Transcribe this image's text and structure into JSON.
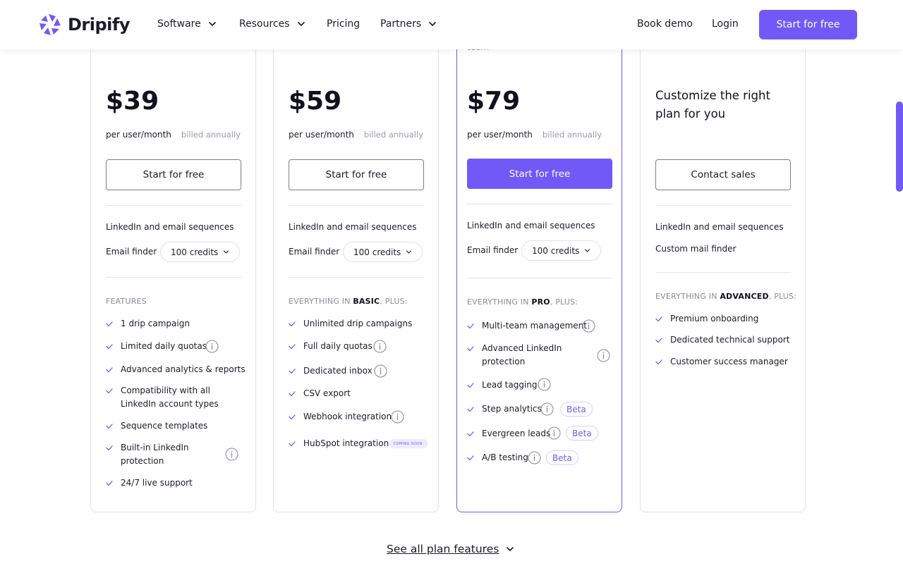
{
  "nav": {
    "logo_text": "Dripify",
    "items": [
      {
        "label": "Software",
        "dropdown": true
      },
      {
        "label": "Resources",
        "dropdown": true
      },
      {
        "label": "Pricing",
        "dropdown": false
      },
      {
        "label": "Partners",
        "dropdown": true
      }
    ],
    "book_demo": "Book demo",
    "login": "Login",
    "cta": "Start for free"
  },
  "accent_color": "#7159f8",
  "plans": [
    {
      "price": "$39",
      "per": "per user/month",
      "billed": "billed annually",
      "button": "Start for free",
      "sequences": "LinkedIn and email sequences",
      "email_finder_label": "Email finder",
      "credits": "100 credits",
      "section_head": "FEATURES",
      "features": [
        "1 drip campaign",
        "Limited daily quotas",
        "Advanced analytics & reports",
        "Compatibility with all LinkedIn account types",
        "Sequence templates",
        "Built-in LinkedIn protection",
        "24/7 live support"
      ]
    },
    {
      "price": "$59",
      "per": "per user/month",
      "billed": "billed annually",
      "button": "Start for free",
      "sequences": "LinkedIn and email sequences",
      "email_finder_label": "Email finder",
      "credits": "100 credits",
      "section_head_prefix": "EVERYTHING IN ",
      "section_head_plan": "BASIC",
      "section_head_suffix": ", PLUS:",
      "features": [
        "Unlimited drip campaigns",
        "Full daily quotas",
        "Dedicated inbox",
        "CSV export",
        "Webhook integration",
        "HubSpot integration"
      ],
      "coming_soon": "COMING SOON"
    },
    {
      "partial_top": "team",
      "price": "$79",
      "per": "per user/month",
      "billed": "billed annually",
      "button": "Start for free",
      "sequences": "LinkedIn and email sequences",
      "email_finder_label": "Email finder",
      "credits": "100 credits",
      "section_head_prefix": "EVERYTHING IN ",
      "section_head_plan": "PRO",
      "section_head_suffix": ", PLUS:",
      "features": [
        "Multi-team management",
        "Advanced LinkedIn protection",
        "Lead tagging",
        "Step analytics",
        "Evergreen leads",
        "A/B testing"
      ],
      "beta_label": "Beta"
    },
    {
      "custom_text": "Customize the right plan for you",
      "button": "Contact sales",
      "sequences": "LinkedIn and email sequences",
      "custom_finder": "Custom mail finder",
      "section_head_prefix": "EVERYTHING IN ",
      "section_head_plan": "ADVANCED",
      "section_head_suffix": ", PLUS:",
      "features": [
        "Premium onboarding",
        "Dedicated technical support",
        "Customer success manager"
      ]
    }
  ],
  "see_all": "See all plan features"
}
